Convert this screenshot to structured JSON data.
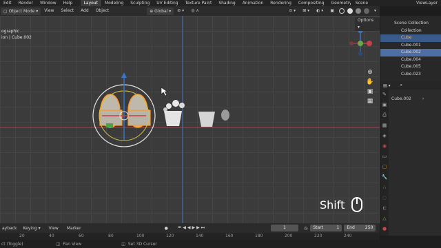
{
  "menu": {
    "items": [
      "Edit",
      "Render",
      "Window",
      "Help"
    ]
  },
  "workspaces": [
    "Layout",
    "Modeling",
    "Sculpting",
    "UV Editing",
    "Texture Paint",
    "Shading",
    "Animation",
    "Rendering",
    "Compositing",
    "Geometry Noc"
  ],
  "active_workspace": "Layout",
  "scene_label": "Scene",
  "view_layer_label": "ViewLayer",
  "viewport_header": {
    "mode": "Object Mode",
    "menus": [
      "View",
      "Select",
      "Add",
      "Object"
    ],
    "transform": "Global",
    "options": "Options"
  },
  "overlay": {
    "line1": "ographic",
    "line2": "ion | Cube.002"
  },
  "outliner": {
    "scene_collection": "Scene Collection",
    "collection": "Collection",
    "items": [
      "Cube",
      "Cube.001",
      "Cube.002",
      "Cube.004",
      "Cube.005",
      "Cube.023"
    ]
  },
  "properties": {
    "object_name": "Cube.002"
  },
  "timeline": {
    "menus": [
      "ayback",
      "Keying",
      "View",
      "Marker"
    ],
    "current_frame": "1",
    "start_label": "Start",
    "start": "1",
    "end_label": "End",
    "end": "250"
  },
  "ruler_ticks": [
    "20",
    "40",
    "60",
    "80",
    "100",
    "120",
    "140",
    "160",
    "180",
    "200",
    "220",
    "240"
  ],
  "status": {
    "left": "ct (Toggle)",
    "mid": "Pan View",
    "right": "Set 3D Cursor"
  },
  "key_hint": "Shift",
  "colors": {
    "accent": "#4e6ea6",
    "selection_orange": "#ffa833",
    "x_axis": "#c4404a",
    "y_axis": "#3a7fd0"
  }
}
